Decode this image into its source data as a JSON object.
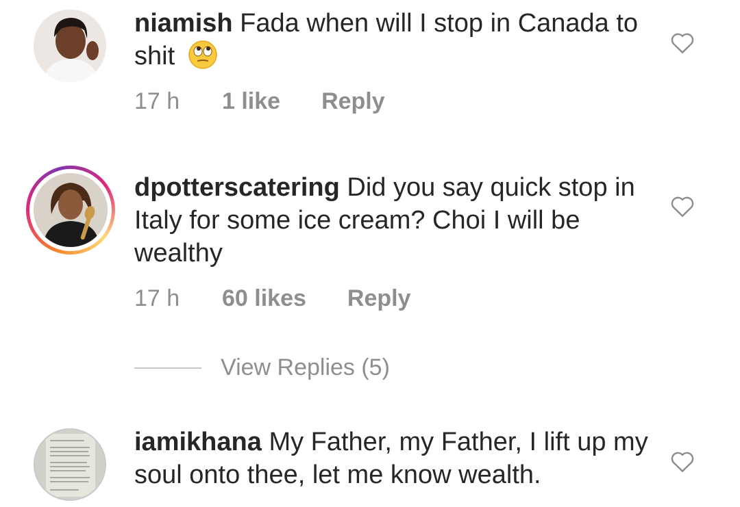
{
  "comments": [
    {
      "username": "niamish",
      "text": "Fada when will I stop in Canada to shit",
      "emoji": "face-with-rolling-eyes",
      "time": "17 h",
      "likes": "1 like",
      "reply": "Reply",
      "has_story_ring": false
    },
    {
      "username": "dpotterscatering",
      "text": "Did you say quick stop in Italy for some ice cream? Choi I will be wealthy",
      "time": "17 h",
      "likes": "60 likes",
      "reply": "Reply",
      "has_story_ring": true
    },
    {
      "username": "iamikhana",
      "text": "My Father, my Father, I lift up my soul onto thee, let me know wealth.",
      "has_story_ring": false
    }
  ],
  "view_replies": "View Replies (5)",
  "icons": {
    "like": "heart-outline-icon",
    "emoji": "rolling-eyes-emoji"
  },
  "colors": {
    "text": "#262626",
    "secondary": "#8e8e8e",
    "divider": "#c7c7c7"
  }
}
